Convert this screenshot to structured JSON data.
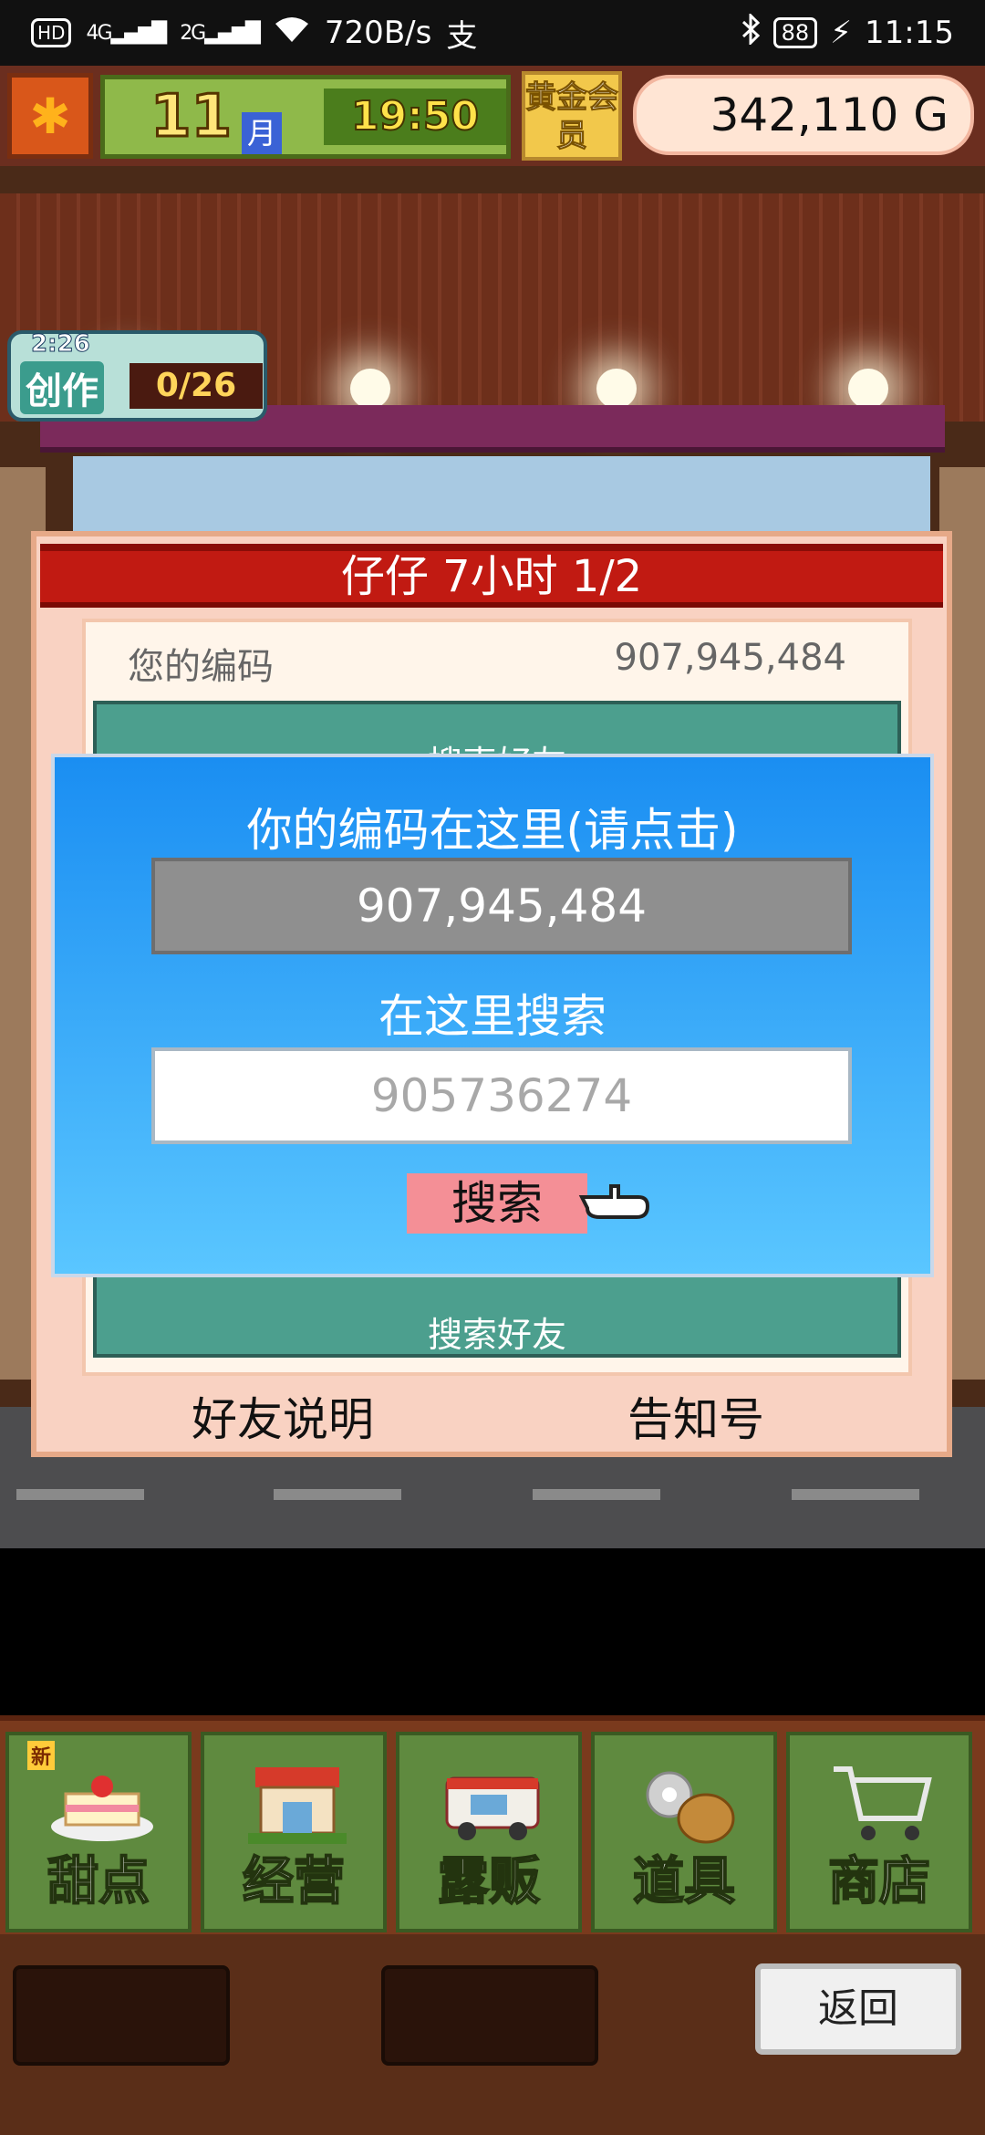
{
  "status_bar": {
    "hd": "HD",
    "net_4g": "4G",
    "net_2g": "2G",
    "speed": "720B/s",
    "app_icon": "支",
    "battery": "88",
    "time": "11:15"
  },
  "hud": {
    "month_num": "11",
    "month_unit": "月",
    "game_time": "19:50",
    "vip_label": "黄金会员",
    "gold": "342,110 G"
  },
  "craft": {
    "timer": "2:26",
    "label": "创作",
    "count": "0/26"
  },
  "panel": {
    "title": "仔仔  7小时 1/2",
    "your_code_label": "您的编码",
    "your_code_value": "907,945,484",
    "partial_header": "搜索好友",
    "search_friends_label": "搜索好友",
    "bottom_left": "好友说明",
    "bottom_right": "告知号"
  },
  "dialog": {
    "title": "你的编码在这里(请点击)",
    "code_value": "907,945,484",
    "search_label": "在这里搜索",
    "search_input_value": "905736274",
    "search_button": "搜索"
  },
  "menu": [
    {
      "label": "甜点",
      "icon": "cake-icon",
      "badge": "新"
    },
    {
      "label": "经营",
      "icon": "shop-icon"
    },
    {
      "label": "露贩",
      "icon": "food-truck-icon"
    },
    {
      "label": "道具",
      "icon": "items-bag-icon"
    },
    {
      "label": "商店",
      "icon": "shopping-cart-icon"
    }
  ],
  "back_button": "返回"
}
